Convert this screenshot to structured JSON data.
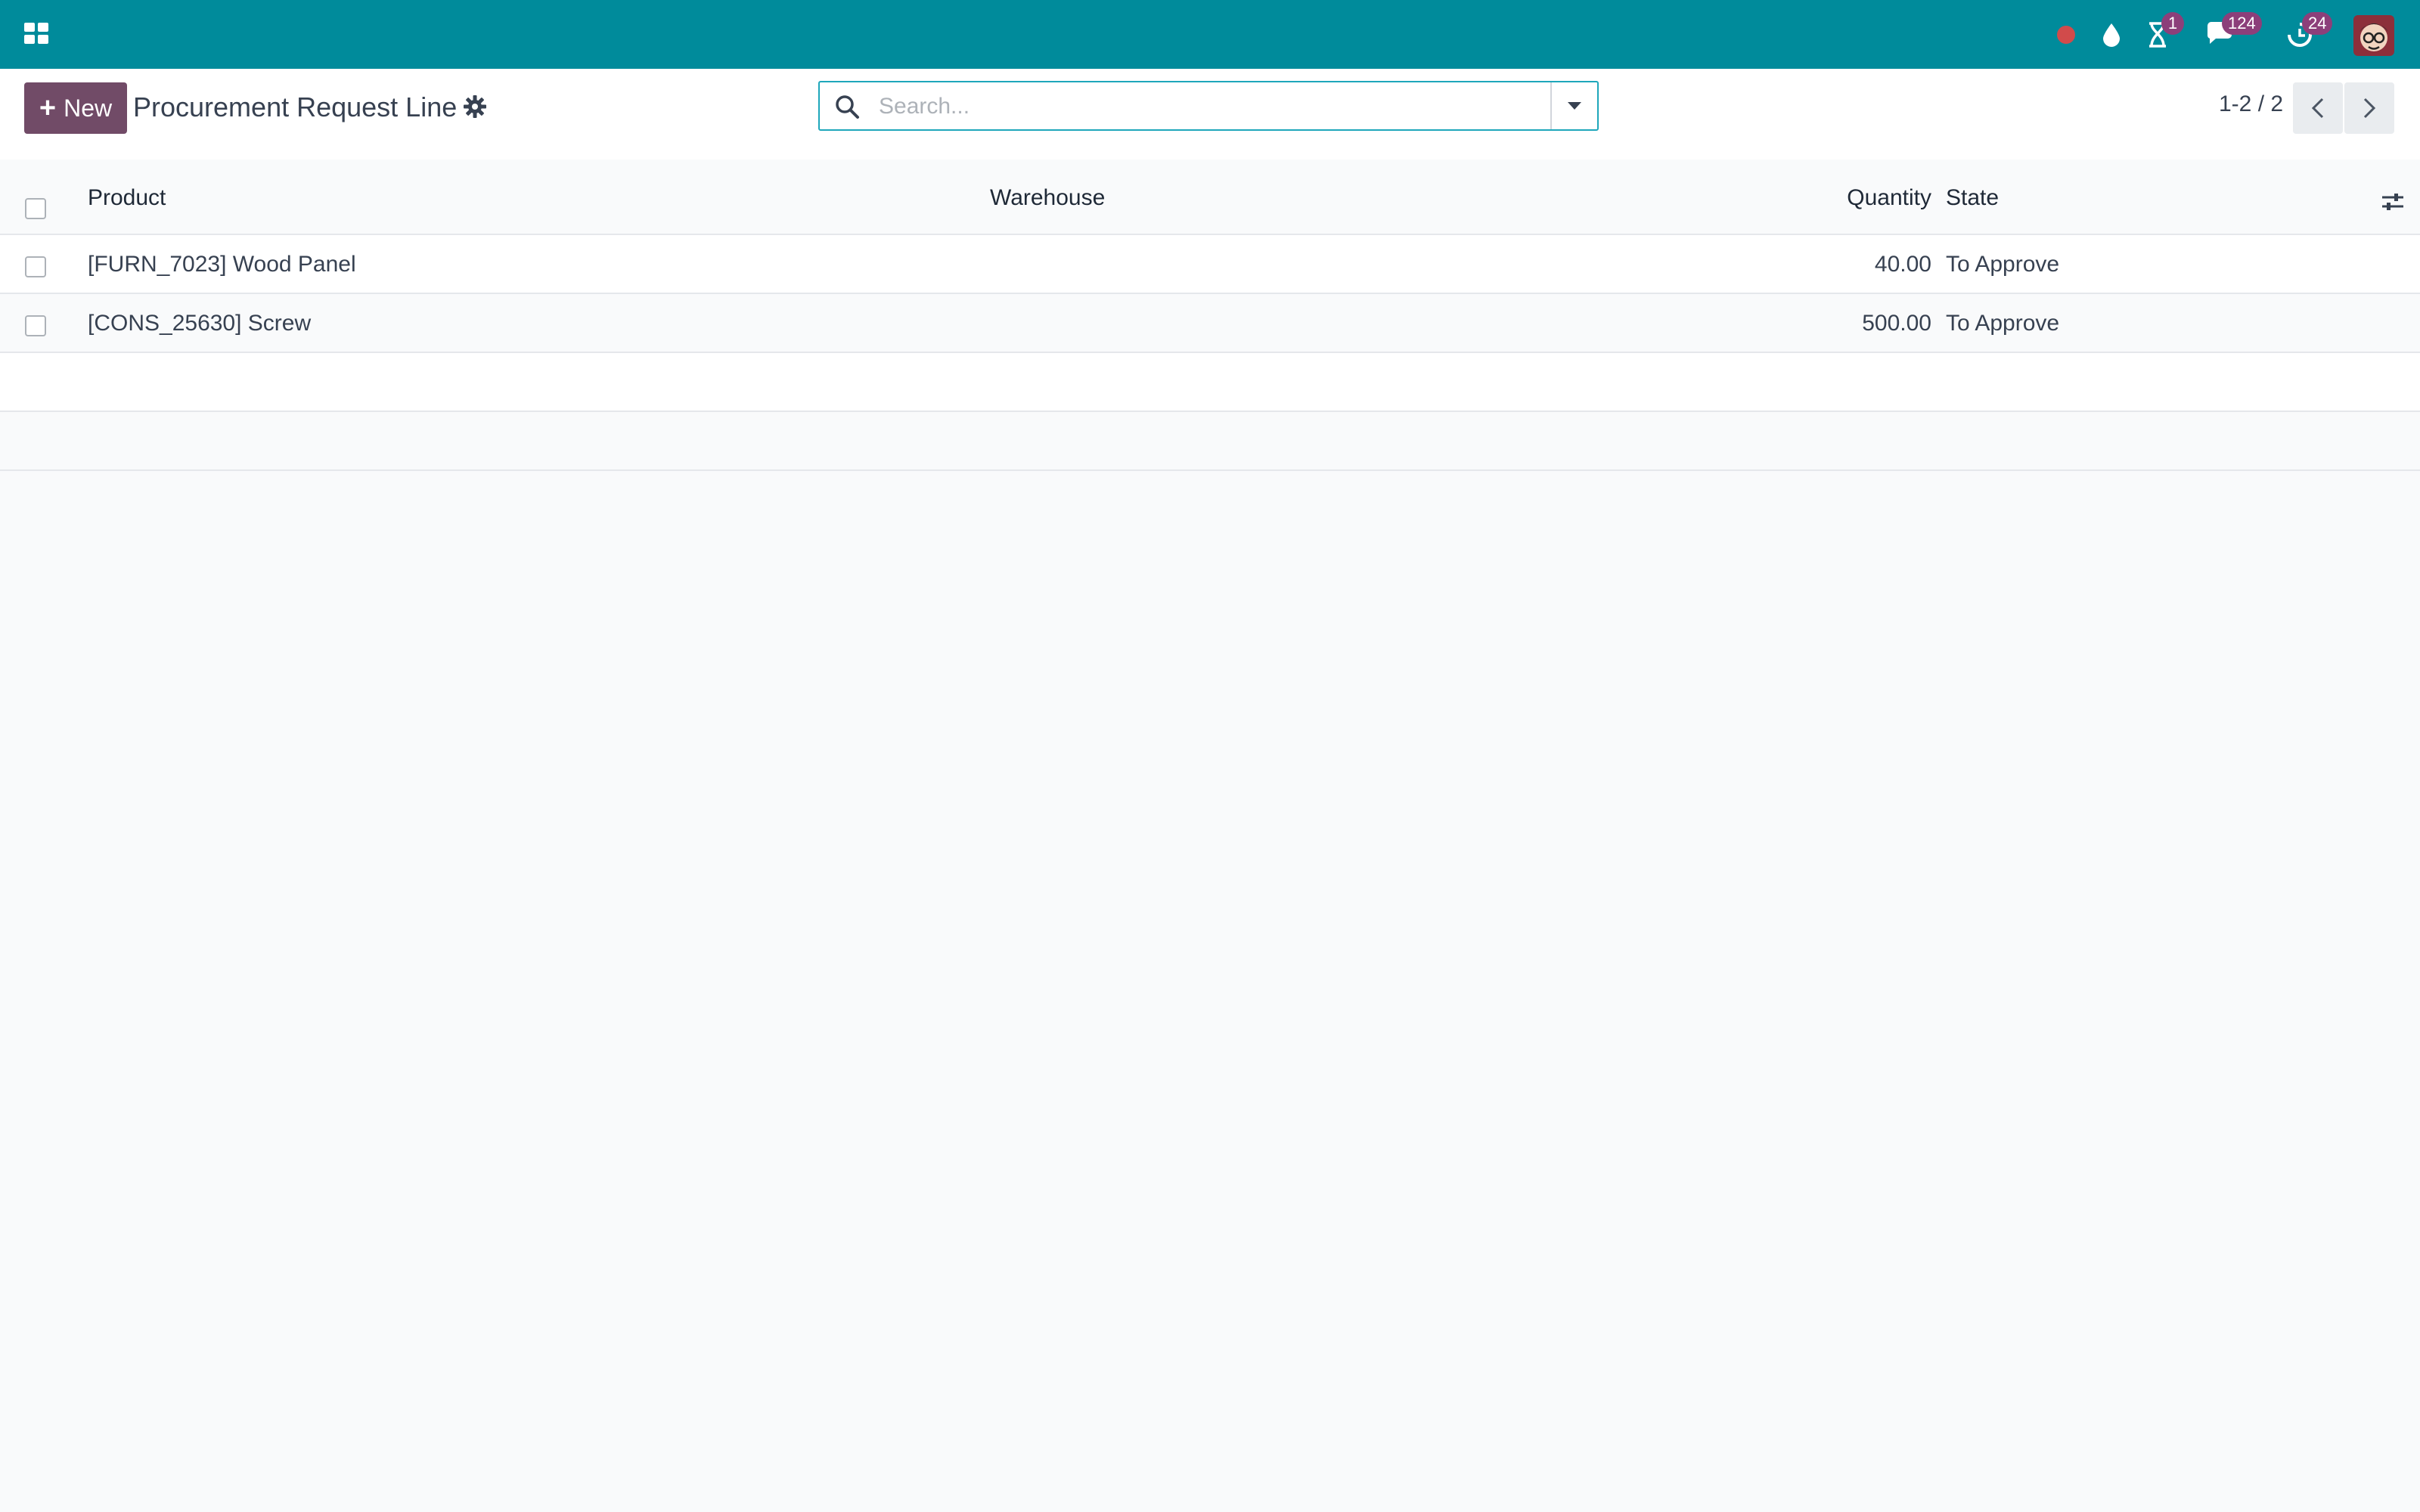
{
  "navbar": {
    "apps_icon": "apps-grid-icon",
    "status_dot_color": "#d14b4b",
    "icons": [
      "status-dot-icon",
      "droplet-icon",
      "hourglass-icon",
      "chat-icon",
      "clock-icon"
    ],
    "activity_badge": "1",
    "messages_badge": "124",
    "clock_badge": "24",
    "bg_color": "#008b9b",
    "badge_color": "#8c3f7a"
  },
  "control_panel": {
    "new_button_label": "New",
    "title": "Procurement Request Line",
    "search_placeholder": "Search...",
    "pager_value": "1-2 / 2",
    "accent_color": "#714b67"
  },
  "list": {
    "columns": {
      "product": "Product",
      "warehouse": "Warehouse",
      "quantity": "Quantity",
      "state": "State"
    },
    "rows": [
      {
        "product": "[FURN_7023] Wood Panel",
        "warehouse": "",
        "quantity": "40.00",
        "state": "To Approve"
      },
      {
        "product": "[CONS_25630] Screw",
        "warehouse": "",
        "quantity": "500.00",
        "state": "To Approve"
      }
    ]
  }
}
